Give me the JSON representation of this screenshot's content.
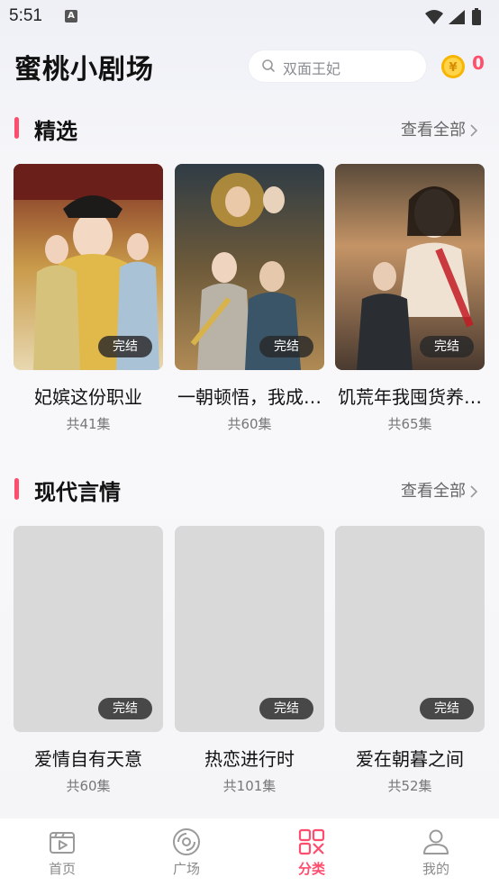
{
  "status_bar": {
    "time": "5:51",
    "notification_icon": "a-letter-icon"
  },
  "header": {
    "app_title": "蜜桃小剧场",
    "search_placeholder": "双面王妃",
    "coin_count": "0"
  },
  "sections": [
    {
      "title": "精选",
      "view_all": "查看全部",
      "dramas": [
        {
          "title": "妃嫔这份职业",
          "episodes": "共41集",
          "badge": "完结"
        },
        {
          "title": "一朝顿悟，我成…",
          "episodes": "共60集",
          "badge": "完结"
        },
        {
          "title": "饥荒年我囤货养…",
          "episodes": "共65集",
          "badge": "完结"
        }
      ]
    },
    {
      "title": "现代言情",
      "view_all": "查看全部",
      "dramas": [
        {
          "title": "爱情自有天意",
          "episodes": "共60集",
          "badge": "完结"
        },
        {
          "title": "热恋进行时",
          "episodes": "共101集",
          "badge": "完结"
        },
        {
          "title": "爱在朝暮之间",
          "episodes": "共52集",
          "badge": "完结"
        }
      ]
    }
  ],
  "tabbar": {
    "items": [
      {
        "label": "首页",
        "icon": "home-play-icon"
      },
      {
        "label": "广场",
        "icon": "disc-icon"
      },
      {
        "label": "分类",
        "icon": "category-icon"
      },
      {
        "label": "我的",
        "icon": "profile-icon"
      }
    ],
    "active_index": 2
  },
  "colors": {
    "accent": "#ff4d6d",
    "coin": "#f5b400"
  }
}
